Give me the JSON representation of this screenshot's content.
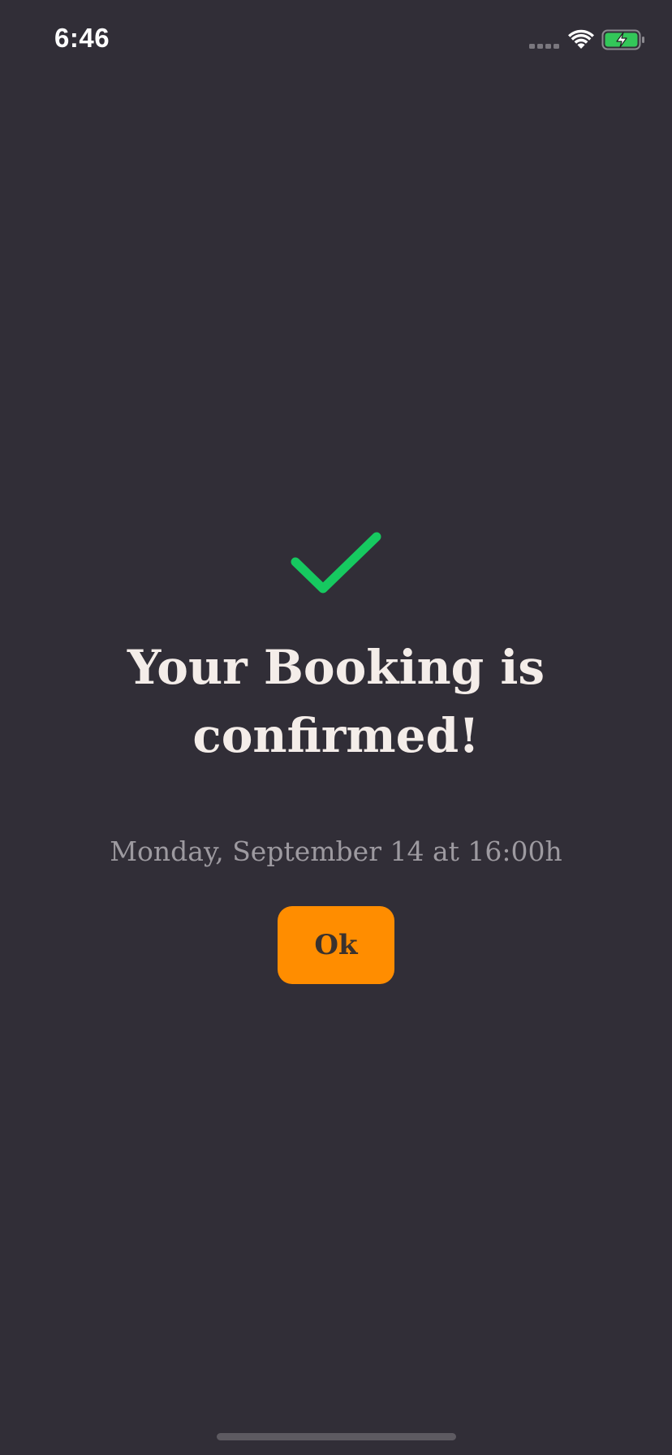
{
  "status_bar": {
    "time": "6:46",
    "icons": [
      "signal-icon",
      "wifi-icon",
      "battery-charging-icon"
    ]
  },
  "confirmation": {
    "icon": "checkmark-icon",
    "title": "Your Booking is confirmed!",
    "subtitle": "Monday, September 14 at 16:00h",
    "ok_label": "Ok"
  },
  "colors": {
    "background": "#312e37",
    "accent": "#ff8d00",
    "success": "#16c960",
    "title_text": "#f4ede9",
    "subtitle_text": "#9d9aa0"
  }
}
